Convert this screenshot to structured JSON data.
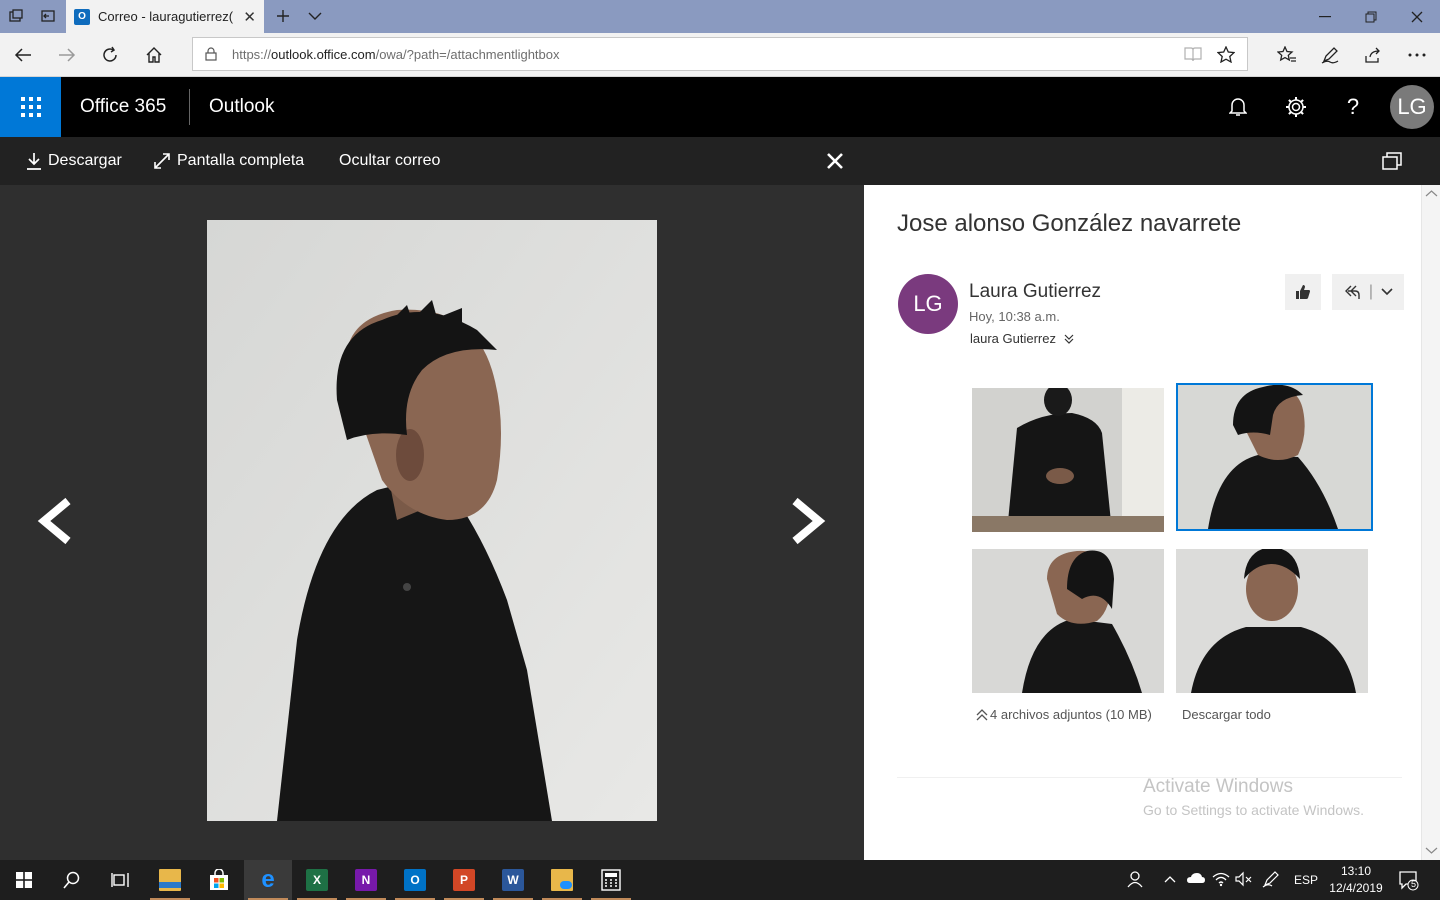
{
  "browser": {
    "tab_title": "Correo - lauragutierrez(",
    "url_prefix": "https://",
    "url_host": "outlook.office.com",
    "url_path": "/owa/?path=/attachmentlightbox"
  },
  "header": {
    "brand": "Office 365",
    "app": "Outlook",
    "user_initials": "LG"
  },
  "lightbox": {
    "download": "Descargar",
    "fullscreen": "Pantalla completa",
    "hide_mail": "Ocultar correo"
  },
  "email": {
    "subject": "Jose alonso González navarrete",
    "sender_initials": "LG",
    "sender": "Laura Gutierrez",
    "date": "Hoy, 10:38 a.m.",
    "to": "laura Gutierrez",
    "attachments_info": "4 archivos adjuntos (10 MB)",
    "download_all": "Descargar todo",
    "selected_attachment": 2
  },
  "watermark": {
    "line1": "Activate Windows",
    "line2": "Go to Settings to activate Windows."
  },
  "taskbar": {
    "lang": "ESP",
    "time": "13:10",
    "date": "12/4/2019",
    "notifications": "5"
  },
  "colors": {
    "accent": "#0078d7",
    "avatar": "#7a3a7e",
    "header_bg": "#000000"
  }
}
